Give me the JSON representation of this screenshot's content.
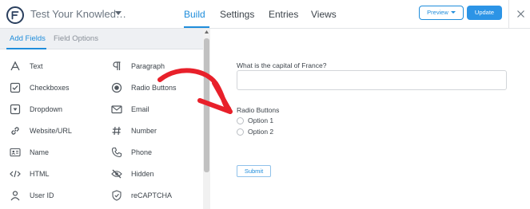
{
  "app": {
    "logo_icon": "wpforms-logo-icon"
  },
  "header": {
    "form_title": "Test Your Knowled…",
    "nav": [
      {
        "label": "Build",
        "active": true
      },
      {
        "label": "Settings",
        "active": false
      },
      {
        "label": "Entries",
        "active": false
      },
      {
        "label": "Views",
        "active": false
      }
    ],
    "preview_label": "Preview",
    "update_label": "Update"
  },
  "sidebar": {
    "tabs": [
      {
        "label": "Add Fields",
        "active": true
      },
      {
        "label": "Field Options",
        "active": false
      }
    ],
    "fields": [
      {
        "label": "Text",
        "icon": "text-icon"
      },
      {
        "label": "Paragraph",
        "icon": "paragraph-icon"
      },
      {
        "label": "Checkboxes",
        "icon": "checkbox-icon"
      },
      {
        "label": "Radio Buttons",
        "icon": "radio-button-icon"
      },
      {
        "label": "Dropdown",
        "icon": "dropdown-icon"
      },
      {
        "label": "Email",
        "icon": "email-icon"
      },
      {
        "label": "Website/URL",
        "icon": "link-icon"
      },
      {
        "label": "Number",
        "icon": "hash-icon"
      },
      {
        "label": "Name",
        "icon": "name-card-icon"
      },
      {
        "label": "Phone",
        "icon": "phone-icon"
      },
      {
        "label": "HTML",
        "icon": "code-icon"
      },
      {
        "label": "Hidden",
        "icon": "eye-slash-icon"
      },
      {
        "label": "User ID",
        "icon": "user-icon"
      },
      {
        "label": "reCAPTCHA",
        "icon": "shield-check-icon"
      }
    ]
  },
  "form": {
    "question_label": "What is the capital of France?",
    "question_value": "",
    "radio_label": "Radio Buttons",
    "options": [
      "Option 1",
      "Option 2"
    ],
    "submit_label": "Submit"
  },
  "colors": {
    "accent": "#1f8ddb",
    "update_button": "#2c94e6",
    "annotation_arrow": "#e8202a"
  }
}
